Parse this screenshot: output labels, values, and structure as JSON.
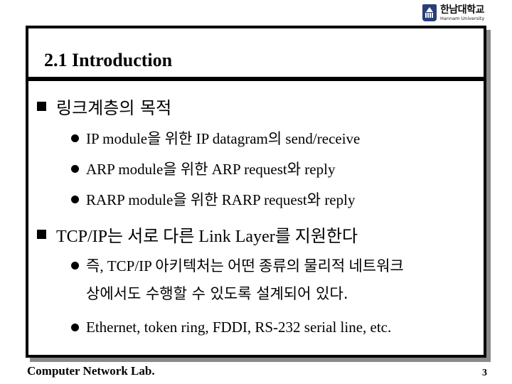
{
  "logo": {
    "icon": "university-emblem-icon",
    "name_kr": "한남대학교",
    "name_en": "Hannam University"
  },
  "slide": {
    "title": "2.1 Introduction",
    "bullets": [
      {
        "text": "링크계층의 목적",
        "sub": [
          "IP module을 위한 IP datagram의 send/receive",
          "ARP module을 위한 ARP request와 reply",
          "RARP module을 위한 RARP request와 reply"
        ]
      },
      {
        "text": "TCP/IP는 서로 다른 Link Layer를 지원한다",
        "sub": [
          "즉, TCP/IP 아키텍처는 어떤 종류의 물리적 네트워크",
          "Ethernet, token ring, FDDI, RS-232 serial line, etc."
        ],
        "sub_continuation": "상에서도 수행할 수 있도록 설계되어 있다."
      }
    ]
  },
  "footer": {
    "lab": "Computer Network Lab.",
    "page_number": "3"
  }
}
